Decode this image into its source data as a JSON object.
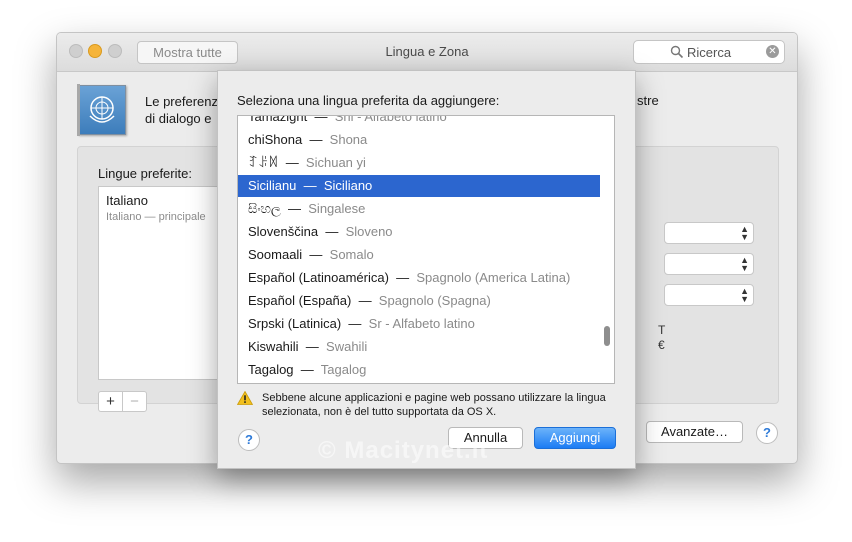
{
  "window": {
    "title": "Lingua e Zona",
    "show_all_label": "Mostra tutte",
    "search_placeholder": "Ricerca"
  },
  "header": {
    "text_line1": "Le preferenz",
    "text_line2": "di dialogo e",
    "tail_text": "stre"
  },
  "preferred": {
    "label": "Lingue preferite:",
    "languages": [
      {
        "name": "Italiano",
        "sub": "Italiano — principale"
      }
    ]
  },
  "right_side": {
    "text1": "T",
    "text2": "€"
  },
  "advanced_label": "Avanzate…",
  "help_label": "?",
  "sheet": {
    "title": "Seleziona una lingua preferita da aggiungere:",
    "rows": [
      {
        "native": "Tamazight",
        "trans": "Shi - Alfabeto latino"
      },
      {
        "native": "chiShona",
        "trans": "Shona"
      },
      {
        "native": "ꆈꌠꉙ",
        "trans": "Sichuan yi"
      },
      {
        "native": "Sicilianu",
        "trans": "Siciliano",
        "selected": true
      },
      {
        "native": "සිංහල",
        "trans": "Singalese"
      },
      {
        "native": "Slovenščina",
        "trans": "Sloveno"
      },
      {
        "native": "Soomaali",
        "trans": "Somalo"
      },
      {
        "native": "Español (Latinoamérica)",
        "trans": "Spagnolo (America Latina)"
      },
      {
        "native": "Español (España)",
        "trans": "Spagnolo (Spagna)"
      },
      {
        "native": "Srpski (Latinica)",
        "trans": "Sr - Alfabeto latino"
      },
      {
        "native": "Kiswahili",
        "trans": "Swahili"
      },
      {
        "native": "Tagalog",
        "trans": "Tagalog"
      }
    ],
    "warning": "Sebbene alcune applicazioni e pagine web possano utilizzare la lingua selezionata, non è del tutto supportata da OS X.",
    "cancel_label": "Annulla",
    "add_label": "Aggiungi"
  },
  "watermark": "© Macitynet.it",
  "colors": {
    "selection": "#2c66cf",
    "default_button": "#1c7cf4",
    "minimize": "#f5b43a"
  }
}
